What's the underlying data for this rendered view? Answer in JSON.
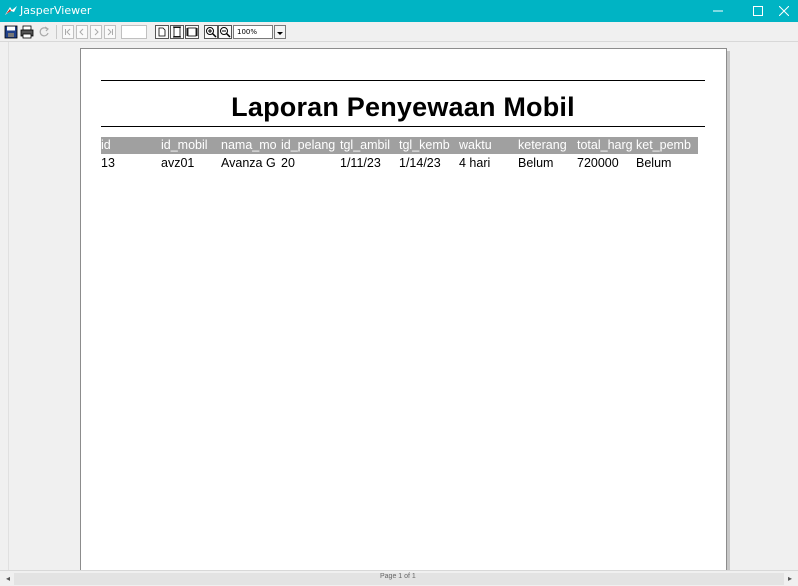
{
  "window": {
    "title": "JasperViewer",
    "controls": [
      "minimize-icon",
      "maximize-icon",
      "close-icon"
    ]
  },
  "toolbar": {
    "buttons": [
      "save-icon",
      "print-icon",
      "reload-icon",
      "first-page-icon",
      "previous-page-icon",
      "next-page-icon",
      "last-page-icon",
      "actual-size-icon",
      "fit-page-icon",
      "fit-width-icon",
      "zoom-in-icon",
      "zoom-out-icon"
    ],
    "page_number": "",
    "zoom": "100%"
  },
  "report": {
    "title": "Laporan Penyewaan Mobil",
    "columns": [
      "id",
      "id_mobil",
      "nama_mo",
      "id_pelang",
      "tgl_ambil",
      "tgl_kemb",
      "waktu",
      "keterang",
      "total_harg",
      "ket_pemb"
    ],
    "rows": [
      [
        "13",
        "avz01",
        "Avanza G",
        "20",
        "1/11/23",
        "1/14/23",
        "4 hari",
        "Belum",
        "720000",
        "Belum"
      ]
    ]
  },
  "status_bar": {
    "page_label": "Page 1 of 1"
  },
  "colors": {
    "titlebar": "#00b4c4",
    "header_band": "#a0a0a0"
  }
}
